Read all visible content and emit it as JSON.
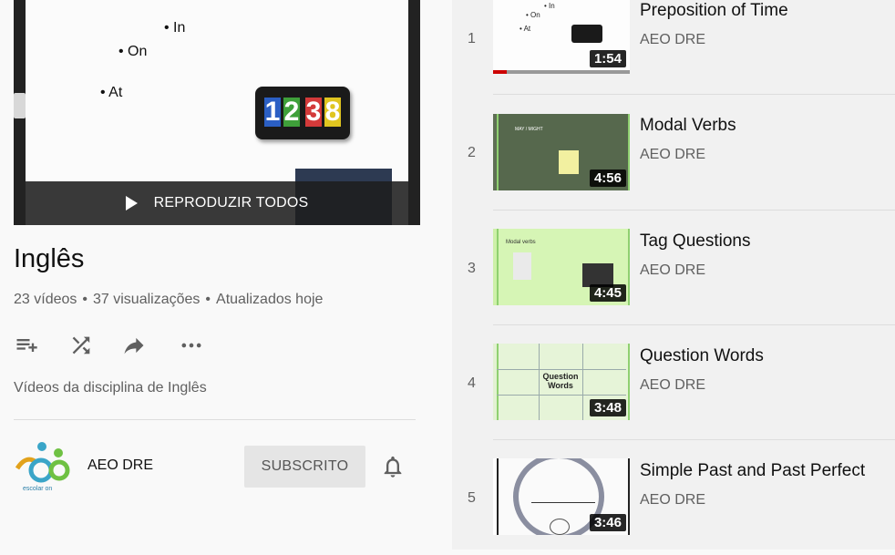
{
  "hero": {
    "slide_points": [
      "• In",
      "• On",
      "• At"
    ],
    "clock_digits": [
      "1",
      "2",
      "3",
      "8"
    ],
    "play_all_label": "REPRODUZIR TODOS"
  },
  "playlist": {
    "title": "Inglês",
    "video_count": "23 vídeos",
    "views": "37 visualizações",
    "updated": "Atualizados hoje",
    "description": "Vídeos da disciplina de Inglês"
  },
  "actions": [
    {
      "name": "add-to-queue-icon"
    },
    {
      "name": "shuffle-icon"
    },
    {
      "name": "share-icon"
    },
    {
      "name": "more-icon"
    }
  ],
  "owner": {
    "name": "AEO DRE",
    "logo_text": "escolar on",
    "subscribe_label": "SUBSCRITO"
  },
  "videos": [
    {
      "index": "1",
      "title": "Preposition of Time",
      "channel": "AEO DRE",
      "duration": "1:54",
      "progress": 0.1
    },
    {
      "index": "2",
      "title": "Modal Verbs",
      "channel": "AEO DRE",
      "duration": "4:56"
    },
    {
      "index": "3",
      "title": "Tag Questions",
      "channel": "AEO DRE",
      "duration": "4:45"
    },
    {
      "index": "4",
      "title": "Question Words",
      "channel": "AEO DRE",
      "duration": "3:48"
    },
    {
      "index": "5",
      "title": "Simple Past and Past Perfect",
      "channel": "AEO DRE",
      "duration": "3:46"
    }
  ],
  "thumb_text": {
    "v2_heading": "MAY / MIGHT",
    "v3_heading": "Modal verbs",
    "v4_center": "Question Words"
  },
  "colors": {
    "accent_red": "#cc0000",
    "button_bg": "#e5e5e5"
  }
}
